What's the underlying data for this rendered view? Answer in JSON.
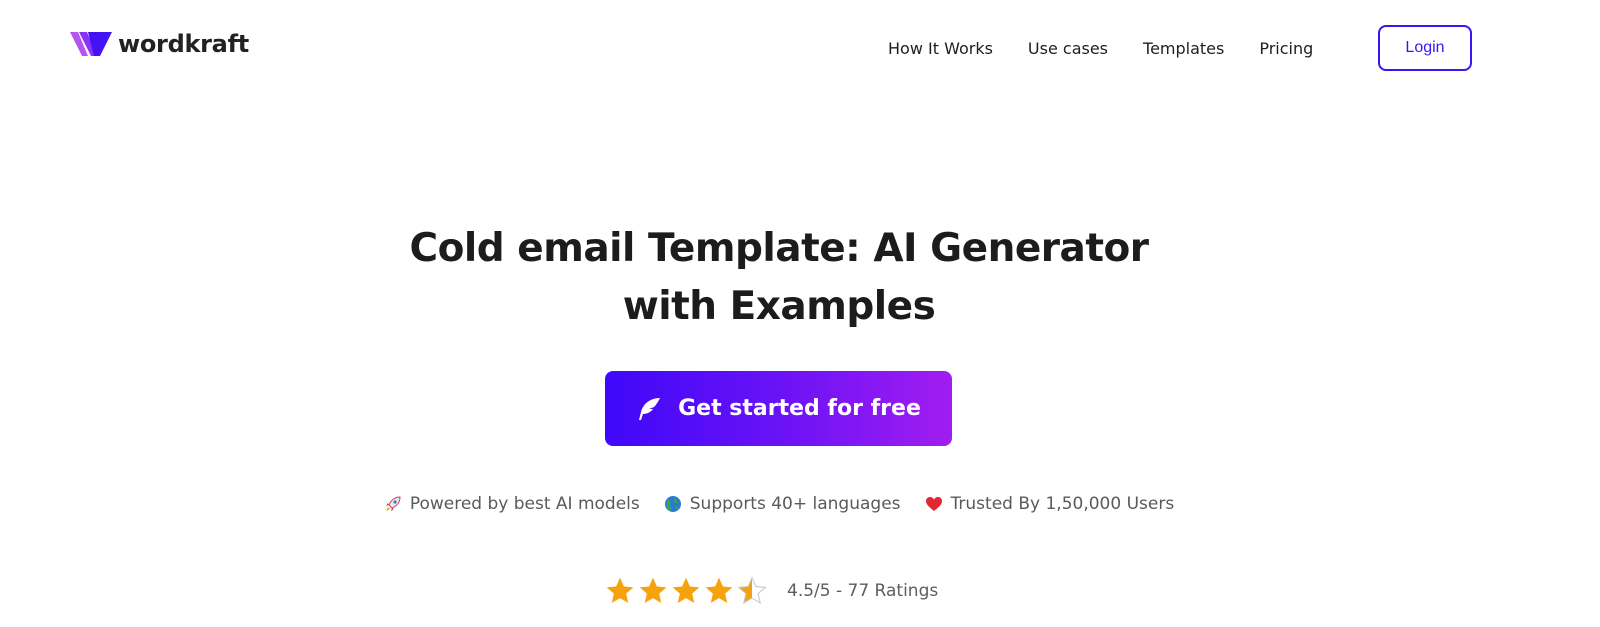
{
  "brand": {
    "name": "wordkraft",
    "logo_icon": "wordkraft-w-logo-icon",
    "colors": {
      "primary": "#3c13f5",
      "gradient_start": "#3f08f9",
      "gradient_end": "#a11df0",
      "star": "#f5a20c"
    }
  },
  "nav": {
    "links": [
      {
        "label": "How It Works"
      },
      {
        "label": "Use cases"
      },
      {
        "label": "Templates"
      },
      {
        "label": "Pricing"
      }
    ],
    "login_label": "Login"
  },
  "hero": {
    "title_line1": "Cold email Template: AI Generator",
    "title_line2": "with Examples",
    "cta_label": "Get started for free",
    "cta_icon": "feather-icon"
  },
  "features": [
    {
      "icon": "rocket-icon",
      "label": "Powered by best AI models"
    },
    {
      "icon": "globe-icon",
      "label": "Supports 40+ languages"
    },
    {
      "icon": "heart-icon",
      "label": "Trusted By 1,50,000 Users"
    }
  ],
  "rating": {
    "value": 4.5,
    "max": 5,
    "text": "4.5/5 - 77 Ratings"
  }
}
